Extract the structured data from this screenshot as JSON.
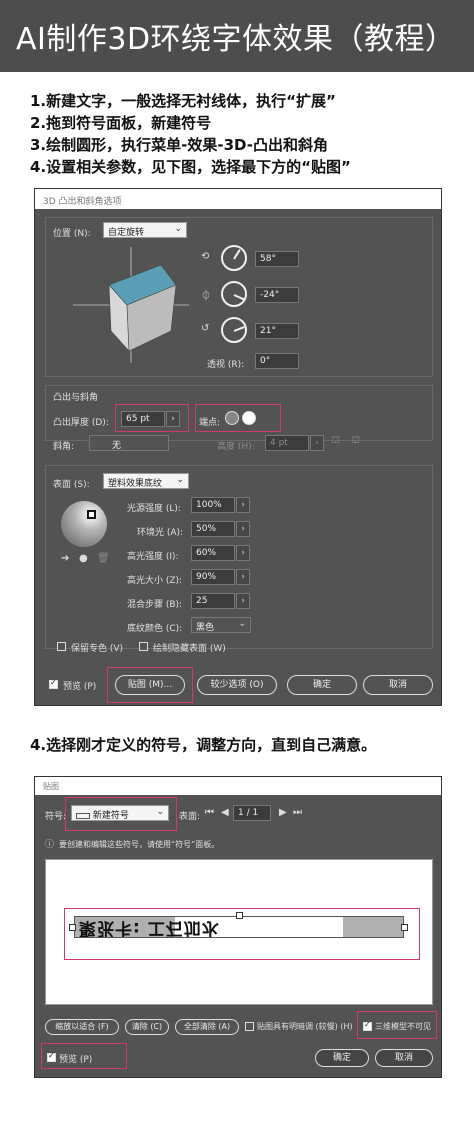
{
  "header": {
    "title": "AI制作3D环绕字体效果（教程）"
  },
  "steps": [
    "1.新建文字，一般选择无衬线体，执行“扩展”",
    "2.拖到符号面板，新建符号",
    "3.绘制圆形，执行菜单-效果-3D-凸出和斜角",
    "4.设置相关参数，见下图，选择最下方的“贴图”"
  ],
  "dialog3d": {
    "title": "3D 凸出和斜角选项",
    "position_label": "位置 (N):",
    "position_value": "自定旋转",
    "rot_x": "58°",
    "rot_y": "-24°",
    "rot_z": "21°",
    "perspective_label": "透视 (R):",
    "perspective_value": "0°",
    "extrude_section": "凸出与斜角",
    "depth_label": "凸出厚度 (D):",
    "depth_value": "65 pt",
    "cap_label": "端点:",
    "bevel_label": "斜角:",
    "bevel_value": "无",
    "height_label": "高度 (H):",
    "height_value": "4 pt",
    "surface_label": "表面 (S):",
    "surface_value": "塑料效果底纹",
    "light_intensity_label": "光源强度 (L):",
    "light_intensity_value": "100%",
    "ambient_label": "环境光 (A):",
    "ambient_value": "50%",
    "highlight_intensity_label": "高光强度 (I):",
    "highlight_intensity_value": "60%",
    "highlight_size_label": "高光大小 (Z):",
    "highlight_size_value": "90%",
    "blend_steps_label": "混合步骤 (B):",
    "blend_steps_value": "25",
    "shading_color_label": "底纹颜色 (C):",
    "shading_color_value": "黑色",
    "preserve_spot_label": "保留专色 (V)",
    "draw_hidden_label": "绘制隐藏表面 (W)",
    "preview_label": "预览 (P)",
    "map_art_button": "贴图 (M)...",
    "fewer_options_button": "较少选项 (O)",
    "ok_button": "确定",
    "cancel_button": "取消",
    "cube_top_color": "#5b9fb6"
  },
  "caption": "4.选择刚才定义的符号，调整方向，直到自己满意。",
  "dialogMap": {
    "title": "贴图",
    "symbol_label": "符号:",
    "symbol_value": "新建符号",
    "surface_label": "表面:",
    "surface_value": "1 / 1",
    "info_text": "要创建和编辑这些符号，请使用“符号”面板。",
    "mapped_text": "聚张卡: 工石加水 ",
    "scale_fit_button": "缩放以适合 (F)",
    "clear_button": "清除 (C)",
    "clear_all_button": "全部清除 (A)",
    "shade_artwork_label": "贴图具有明暗调 (较慢) (H)",
    "invisible_geometry_label": "三维模型不可见",
    "preview_label": "预览 (P)",
    "ok_button": "确定",
    "cancel_button": "取消"
  },
  "accent_colors": {
    "highlight_box": "#d13a6a",
    "panel_bg": "#535353",
    "title_bg": "#4d4d4d"
  }
}
